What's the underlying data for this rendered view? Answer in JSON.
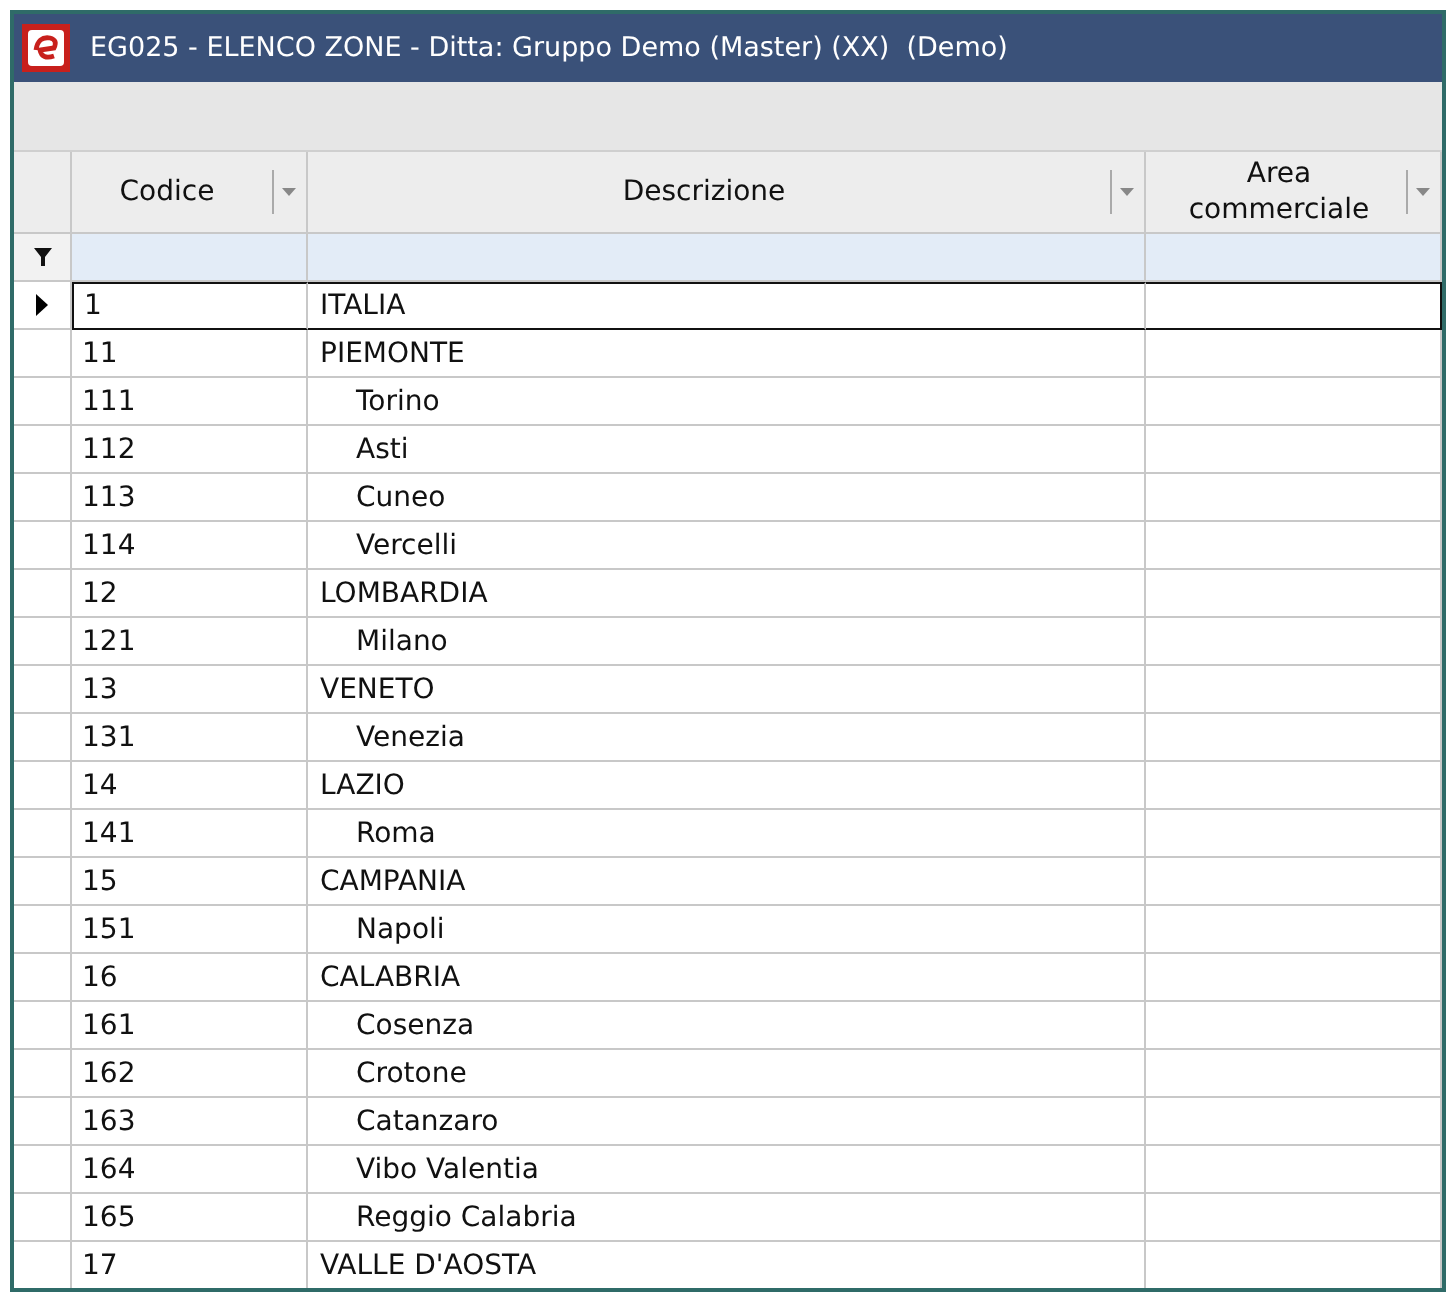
{
  "window": {
    "title": "EG025 - ELENCO ZONE - Ditta: Gruppo Demo (Master) (XX)  (Demo)"
  },
  "table": {
    "columns": [
      "Codice",
      "Descrizione",
      "Area commerciale"
    ],
    "rows": [
      {
        "code": "1",
        "description": "ITALIA",
        "selected": true
      },
      {
        "code": "11",
        "description": "PIEMONTE",
        "selected": false,
        "children": [
          {
            "code": "111",
            "description": "Torino",
            "selected": false
          },
          {
            "code": "112",
            "description": "Asti",
            "selected": false
          },
          {
            "code": "113",
            "description": "Cuneo",
            "selected": false
          },
          {
            "code": "114",
            "description": "Vercelli",
            "selected": false
          }
        ]
      },
      {
        "code": "12",
        "description": "LOMBARDIA",
        "selected": false,
        "children": [
          {
            "code": "121",
            "description": "Milano",
            "selected": false
          }
        ]
      },
      {
        "code": "13",
        "description": "VENETO",
        "selected": false,
        "children": [
          {
            "code": "131",
            "description": "Venezia",
            "selected": false
          }
        ]
      },
      {
        "code": "14",
        "description": "LAZIO",
        "selected": false,
        "children": [
          {
            "code": "141",
            "description": "Roma",
            "selected": false
          }
        ]
      },
      {
        "code": "15",
        "description": "CAMPANIA",
        "selected": false,
        "children": [
          {
            "code": "151",
            "description": "Napoli",
            "selected": false
          }
        ]
      },
      {
        "code": "16",
        "description": "CALABRIA",
        "selected": false,
        "children": [
          {
            "code": "161",
            "description": "Cosenza",
            "selected": false
          },
          {
            "code": "162",
            "description": "Crotone",
            "selected": false
          },
          {
            "code": "163",
            "description": "Catanzaro",
            "selected": false
          },
          {
            "code": "164",
            "description": "Vibo Valentia",
            "selected": false
          },
          {
            "code": "165",
            "description": "Reggio Calabria",
            "selected": false
          }
        ]
      },
      {
        "code": "17",
        "description": "VALLE D'AOSTA",
        "selected": false
      }
    ]
  }
}
